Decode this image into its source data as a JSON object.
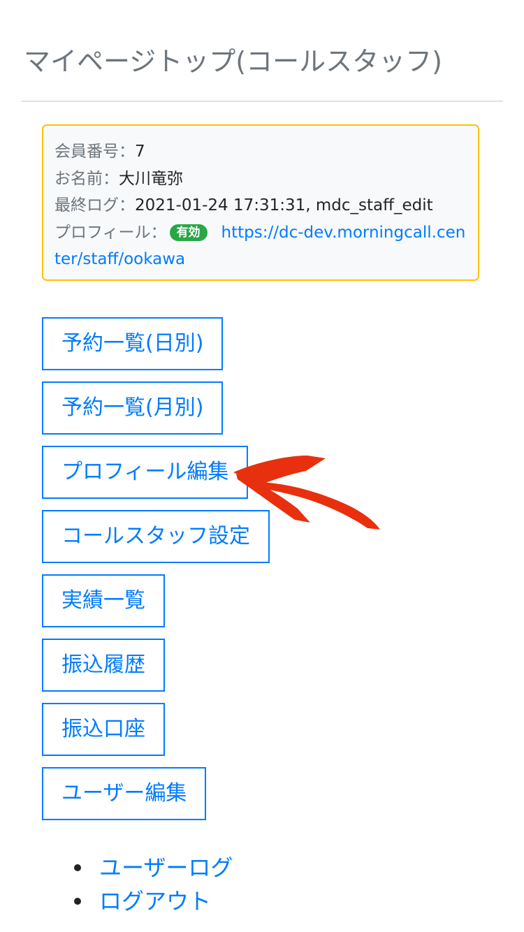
{
  "page": {
    "title": "マイページトップ(コールスタッフ)"
  },
  "member_info": {
    "number_label": "会員番号：",
    "number_value": "7",
    "name_label": "お名前：",
    "name_value": "大川竜弥",
    "last_log_label": "最終ログ：",
    "last_log_value": "2021-01-24 17:31:31, mdc_staff_edit",
    "profile_label": "プロフィール：",
    "profile_status": "有効",
    "profile_url": "https://dc-dev.morningcall.center/staff/ookawa"
  },
  "menu": {
    "buttons": [
      {
        "label": "予約一覧(日別)"
      },
      {
        "label": "予約一覧(月別)"
      },
      {
        "label": "プロフィール編集"
      },
      {
        "label": "コールスタッフ設定"
      },
      {
        "label": "実績一覧"
      },
      {
        "label": "振込履歴"
      },
      {
        "label": "振込口座"
      },
      {
        "label": "ユーザー編集"
      }
    ]
  },
  "links": [
    {
      "label": "ユーザーログ"
    },
    {
      "label": "ログアウト"
    }
  ],
  "colors": {
    "accent": "#007bff",
    "card_border": "#ffc107",
    "badge_success": "#28a745",
    "annotation_arrow": "#e8300e"
  },
  "icons": {
    "annotation": "arrow-pointing-icon"
  }
}
